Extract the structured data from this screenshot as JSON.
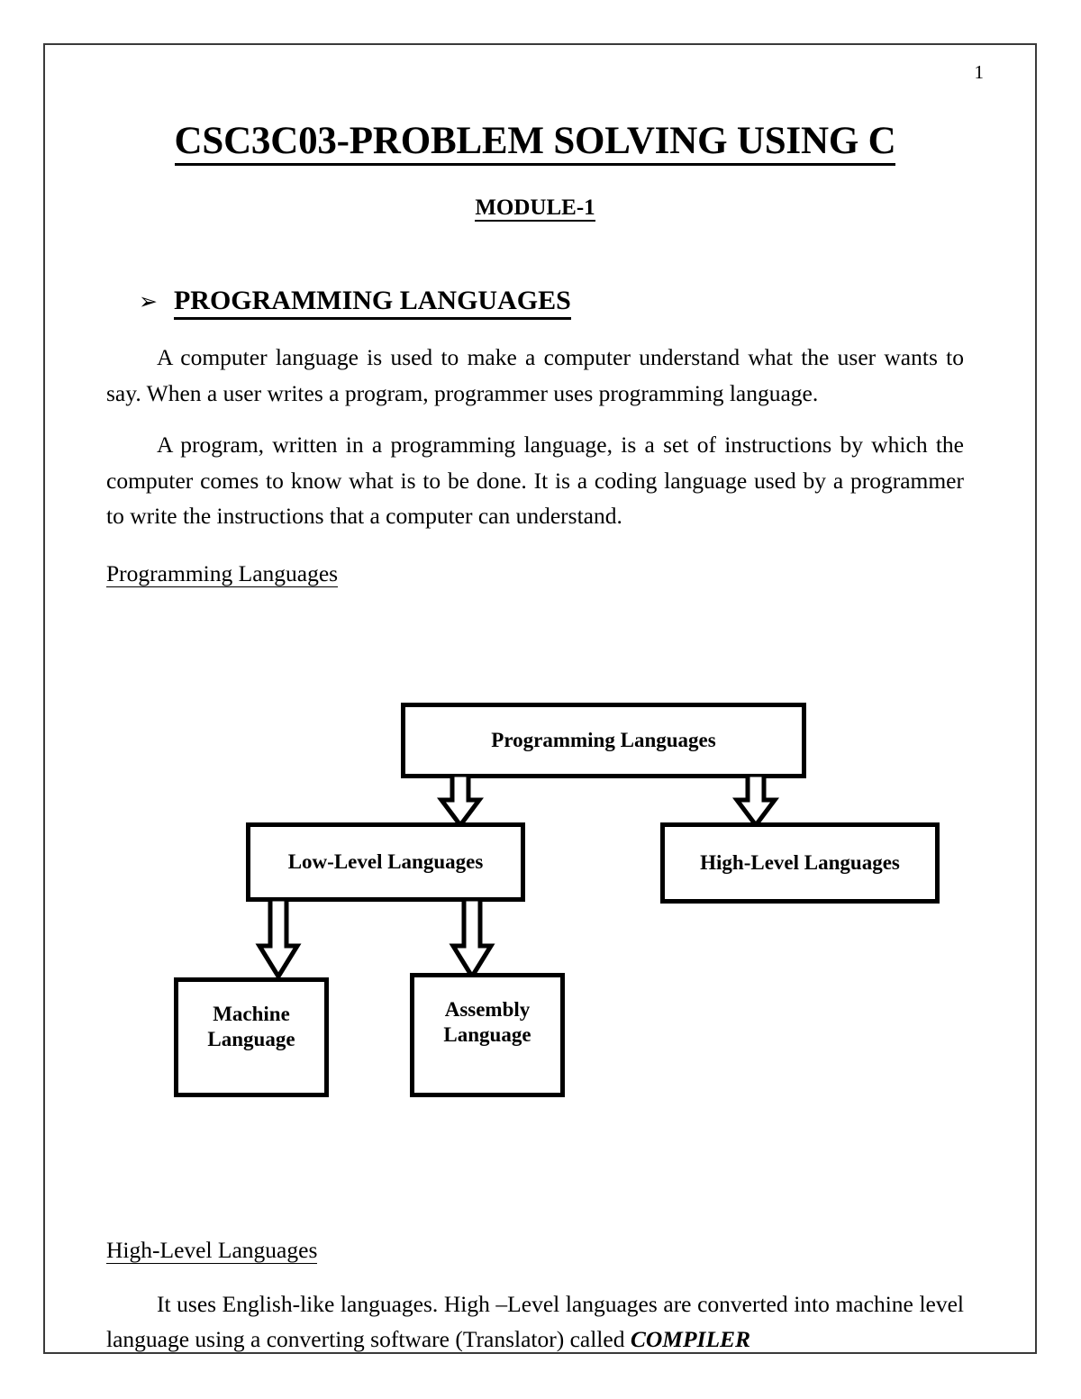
{
  "page": {
    "number": "1",
    "border_color": "#3a3a3a",
    "background": "#ffffff",
    "text_color": "#000000"
  },
  "header": {
    "title": "CSC3C03-PROBLEM SOLVING USING C",
    "module": "MODULE-1"
  },
  "section": {
    "bullet_glyph": "➢",
    "heading": "PROGRAMMING LANGUAGES",
    "paragraph_1": "A computer language is used to make a computer understand what the user wants to say. When a user writes a program, programmer uses programming language.",
    "paragraph_2": "A program,  written in a programming language, is a set of instructions by which the computer comes to know what is to be done. It is a coding language used by a programmer to write the instructions that a computer can understand.",
    "figure_caption": "Programming Languages"
  },
  "diagram": {
    "type": "hierarchy-tree",
    "boxes": {
      "root": "Programming Languages",
      "low_level": "Low-Level Languages",
      "high_level": "High-Level Languages",
      "machine": "Machine\nLanguage",
      "assembly": "Assembly\nLanguage"
    },
    "arrows": [
      {
        "name": "root-to-low-level",
        "direction": "down"
      },
      {
        "name": "root-to-high-level",
        "direction": "down"
      },
      {
        "name": "low-level-to-machine",
        "direction": "down"
      },
      {
        "name": "low-level-to-assembly",
        "direction": "down"
      }
    ],
    "box_border_color": "#000000",
    "box_fill": "#ffffff"
  },
  "tail": {
    "sub_heading": "High-Level Languages",
    "paragraph_lead": "It uses English-like languages. High –Level languages are converted into machine level language using a converting software (Translator) called ",
    "paragraph_emphasis": "COMPILER"
  }
}
